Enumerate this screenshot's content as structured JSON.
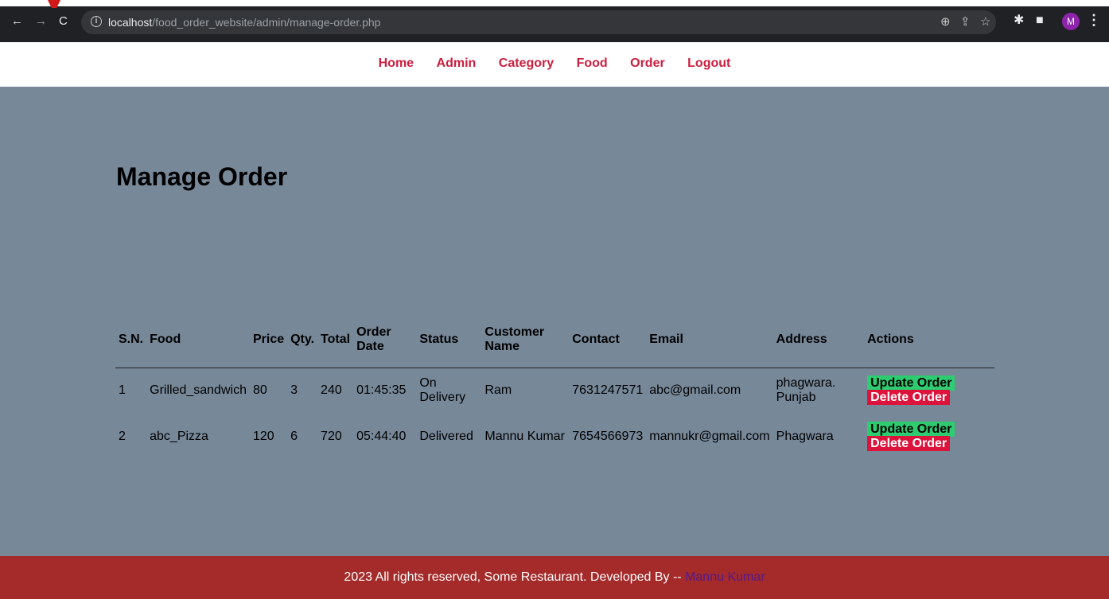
{
  "browser": {
    "url_host": "localhost",
    "url_path": "/food_order_website/admin/manage-order.php",
    "avatar_letter": "M"
  },
  "nav": {
    "items": [
      {
        "label": "Home"
      },
      {
        "label": "Admin"
      },
      {
        "label": "Category"
      },
      {
        "label": "Food"
      },
      {
        "label": "Order"
      },
      {
        "label": "Logout"
      }
    ]
  },
  "page": {
    "title": "Manage Order"
  },
  "table": {
    "headers": {
      "sn": "S.N.",
      "food": "Food",
      "price": "Price",
      "qty": "Qty.",
      "total": "Total",
      "order_date": "Order Date",
      "status": "Status",
      "customer_name": "Customer Name",
      "contact": "Contact",
      "email": "Email",
      "address": "Address",
      "actions": "Actions"
    },
    "rows": [
      {
        "sn": "1",
        "food": "Grilled_sandwich",
        "price": "80",
        "qty": "3",
        "total": "240",
        "order_date": "01:45:35",
        "status": "On Delivery",
        "customer_name": "Ram",
        "contact": "7631247571",
        "email": "abc@gmail.com",
        "address": "phagwara. Punjab",
        "update_label": "Update Order",
        "delete_label": "Delete Order"
      },
      {
        "sn": "2",
        "food": "abc_Pizza",
        "price": "120",
        "qty": "6",
        "total": "720",
        "order_date": "05:44:40",
        "status": "Delivered",
        "customer_name": "Mannu Kumar",
        "contact": "7654566973",
        "email": "mannukr@gmail.com",
        "address": "Phagwara",
        "update_label": "Update Order",
        "delete_label": "Delete Order"
      }
    ]
  },
  "footer": {
    "text": "2023 All rights reserved, Some Restaurant. Developed By -- ",
    "link": "Mannu Kumar"
  },
  "colors": {
    "menu_link": "#cc1e3f",
    "main_bg": "#778899",
    "footer_bg": "#a52a2a",
    "update_btn": "#2ecc71",
    "delete_btn": "#dc143c",
    "status_on_delivery": "#ffa500",
    "status_delivered": "#2ca02c"
  }
}
